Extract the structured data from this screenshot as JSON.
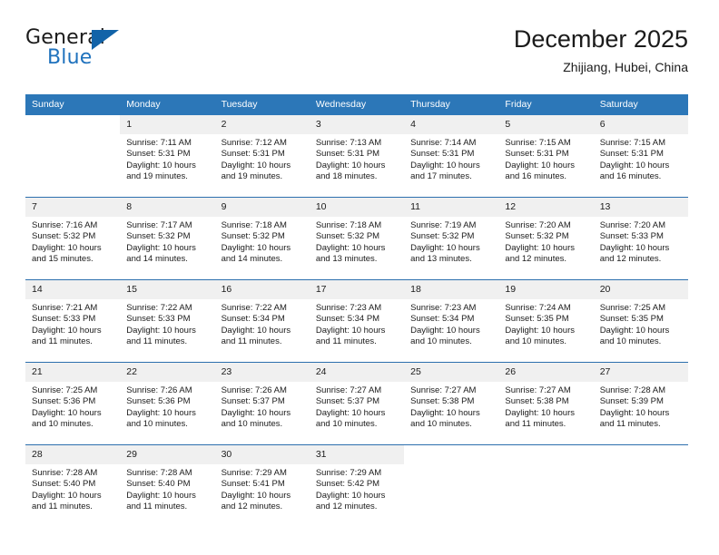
{
  "brand": {
    "word_one": "General",
    "word_two": "Blue",
    "flag_icon": "flag-triangle-icon"
  },
  "header": {
    "title": "December 2025",
    "subtitle": "Zhijiang, Hubei, China"
  },
  "colors": {
    "header_blue": "#2c77b8",
    "separator_blue": "#2c6fae",
    "daynum_band": "#f0f0f0",
    "brand_blue": "#1f72bd",
    "text": "#1b1b1b"
  },
  "weekday_headers": [
    "Sunday",
    "Monday",
    "Tuesday",
    "Wednesday",
    "Thursday",
    "Friday",
    "Saturday"
  ],
  "weeks": [
    [
      {
        "day": "",
        "blank": true,
        "empty": true,
        "sunrise": "",
        "sunset": "",
        "daylight_line1": "",
        "daylight_line2": ""
      },
      {
        "day": "1",
        "sunrise": "Sunrise: 7:11 AM",
        "sunset": "Sunset: 5:31 PM",
        "daylight_line1": "Daylight: 10 hours",
        "daylight_line2": "and 19 minutes."
      },
      {
        "day": "2",
        "sunrise": "Sunrise: 7:12 AM",
        "sunset": "Sunset: 5:31 PM",
        "daylight_line1": "Daylight: 10 hours",
        "daylight_line2": "and 19 minutes."
      },
      {
        "day": "3",
        "sunrise": "Sunrise: 7:13 AM",
        "sunset": "Sunset: 5:31 PM",
        "daylight_line1": "Daylight: 10 hours",
        "daylight_line2": "and 18 minutes."
      },
      {
        "day": "4",
        "sunrise": "Sunrise: 7:14 AM",
        "sunset": "Sunset: 5:31 PM",
        "daylight_line1": "Daylight: 10 hours",
        "daylight_line2": "and 17 minutes."
      },
      {
        "day": "5",
        "sunrise": "Sunrise: 7:15 AM",
        "sunset": "Sunset: 5:31 PM",
        "daylight_line1": "Daylight: 10 hours",
        "daylight_line2": "and 16 minutes."
      },
      {
        "day": "6",
        "sunrise": "Sunrise: 7:15 AM",
        "sunset": "Sunset: 5:31 PM",
        "daylight_line1": "Daylight: 10 hours",
        "daylight_line2": "and 16 minutes."
      }
    ],
    [
      {
        "day": "7",
        "sunrise": "Sunrise: 7:16 AM",
        "sunset": "Sunset: 5:32 PM",
        "daylight_line1": "Daylight: 10 hours",
        "daylight_line2": "and 15 minutes."
      },
      {
        "day": "8",
        "sunrise": "Sunrise: 7:17 AM",
        "sunset": "Sunset: 5:32 PM",
        "daylight_line1": "Daylight: 10 hours",
        "daylight_line2": "and 14 minutes."
      },
      {
        "day": "9",
        "sunrise": "Sunrise: 7:18 AM",
        "sunset": "Sunset: 5:32 PM",
        "daylight_line1": "Daylight: 10 hours",
        "daylight_line2": "and 14 minutes."
      },
      {
        "day": "10",
        "sunrise": "Sunrise: 7:18 AM",
        "sunset": "Sunset: 5:32 PM",
        "daylight_line1": "Daylight: 10 hours",
        "daylight_line2": "and 13 minutes."
      },
      {
        "day": "11",
        "sunrise": "Sunrise: 7:19 AM",
        "sunset": "Sunset: 5:32 PM",
        "daylight_line1": "Daylight: 10 hours",
        "daylight_line2": "and 13 minutes."
      },
      {
        "day": "12",
        "sunrise": "Sunrise: 7:20 AM",
        "sunset": "Sunset: 5:32 PM",
        "daylight_line1": "Daylight: 10 hours",
        "daylight_line2": "and 12 minutes."
      },
      {
        "day": "13",
        "sunrise": "Sunrise: 7:20 AM",
        "sunset": "Sunset: 5:33 PM",
        "daylight_line1": "Daylight: 10 hours",
        "daylight_line2": "and 12 minutes."
      }
    ],
    [
      {
        "day": "14",
        "sunrise": "Sunrise: 7:21 AM",
        "sunset": "Sunset: 5:33 PM",
        "daylight_line1": "Daylight: 10 hours",
        "daylight_line2": "and 11 minutes."
      },
      {
        "day": "15",
        "sunrise": "Sunrise: 7:22 AM",
        "sunset": "Sunset: 5:33 PM",
        "daylight_line1": "Daylight: 10 hours",
        "daylight_line2": "and 11 minutes."
      },
      {
        "day": "16",
        "sunrise": "Sunrise: 7:22 AM",
        "sunset": "Sunset: 5:34 PM",
        "daylight_line1": "Daylight: 10 hours",
        "daylight_line2": "and 11 minutes."
      },
      {
        "day": "17",
        "sunrise": "Sunrise: 7:23 AM",
        "sunset": "Sunset: 5:34 PM",
        "daylight_line1": "Daylight: 10 hours",
        "daylight_line2": "and 11 minutes."
      },
      {
        "day": "18",
        "sunrise": "Sunrise: 7:23 AM",
        "sunset": "Sunset: 5:34 PM",
        "daylight_line1": "Daylight: 10 hours",
        "daylight_line2": "and 10 minutes."
      },
      {
        "day": "19",
        "sunrise": "Sunrise: 7:24 AM",
        "sunset": "Sunset: 5:35 PM",
        "daylight_line1": "Daylight: 10 hours",
        "daylight_line2": "and 10 minutes."
      },
      {
        "day": "20",
        "sunrise": "Sunrise: 7:25 AM",
        "sunset": "Sunset: 5:35 PM",
        "daylight_line1": "Daylight: 10 hours",
        "daylight_line2": "and 10 minutes."
      }
    ],
    [
      {
        "day": "21",
        "sunrise": "Sunrise: 7:25 AM",
        "sunset": "Sunset: 5:36 PM",
        "daylight_line1": "Daylight: 10 hours",
        "daylight_line2": "and 10 minutes."
      },
      {
        "day": "22",
        "sunrise": "Sunrise: 7:26 AM",
        "sunset": "Sunset: 5:36 PM",
        "daylight_line1": "Daylight: 10 hours",
        "daylight_line2": "and 10 minutes."
      },
      {
        "day": "23",
        "sunrise": "Sunrise: 7:26 AM",
        "sunset": "Sunset: 5:37 PM",
        "daylight_line1": "Daylight: 10 hours",
        "daylight_line2": "and 10 minutes."
      },
      {
        "day": "24",
        "sunrise": "Sunrise: 7:27 AM",
        "sunset": "Sunset: 5:37 PM",
        "daylight_line1": "Daylight: 10 hours",
        "daylight_line2": "and 10 minutes."
      },
      {
        "day": "25",
        "sunrise": "Sunrise: 7:27 AM",
        "sunset": "Sunset: 5:38 PM",
        "daylight_line1": "Daylight: 10 hours",
        "daylight_line2": "and 10 minutes."
      },
      {
        "day": "26",
        "sunrise": "Sunrise: 7:27 AM",
        "sunset": "Sunset: 5:38 PM",
        "daylight_line1": "Daylight: 10 hours",
        "daylight_line2": "and 11 minutes."
      },
      {
        "day": "27",
        "sunrise": "Sunrise: 7:28 AM",
        "sunset": "Sunset: 5:39 PM",
        "daylight_line1": "Daylight: 10 hours",
        "daylight_line2": "and 11 minutes."
      }
    ],
    [
      {
        "day": "28",
        "sunrise": "Sunrise: 7:28 AM",
        "sunset": "Sunset: 5:40 PM",
        "daylight_line1": "Daylight: 10 hours",
        "daylight_line2": "and 11 minutes."
      },
      {
        "day": "29",
        "sunrise": "Sunrise: 7:28 AM",
        "sunset": "Sunset: 5:40 PM",
        "daylight_line1": "Daylight: 10 hours",
        "daylight_line2": "and 11 minutes."
      },
      {
        "day": "30",
        "sunrise": "Sunrise: 7:29 AM",
        "sunset": "Sunset: 5:41 PM",
        "daylight_line1": "Daylight: 10 hours",
        "daylight_line2": "and 12 minutes."
      },
      {
        "day": "31",
        "sunrise": "Sunrise: 7:29 AM",
        "sunset": "Sunset: 5:42 PM",
        "daylight_line1": "Daylight: 10 hours",
        "daylight_line2": "and 12 minutes."
      },
      {
        "day": "",
        "blank": true,
        "empty": true,
        "sunrise": "",
        "sunset": "",
        "daylight_line1": "",
        "daylight_line2": ""
      },
      {
        "day": "",
        "blank": true,
        "empty": true,
        "sunrise": "",
        "sunset": "",
        "daylight_line1": "",
        "daylight_line2": ""
      },
      {
        "day": "",
        "blank": true,
        "empty": true,
        "sunrise": "",
        "sunset": "",
        "daylight_line1": "",
        "daylight_line2": ""
      }
    ]
  ]
}
